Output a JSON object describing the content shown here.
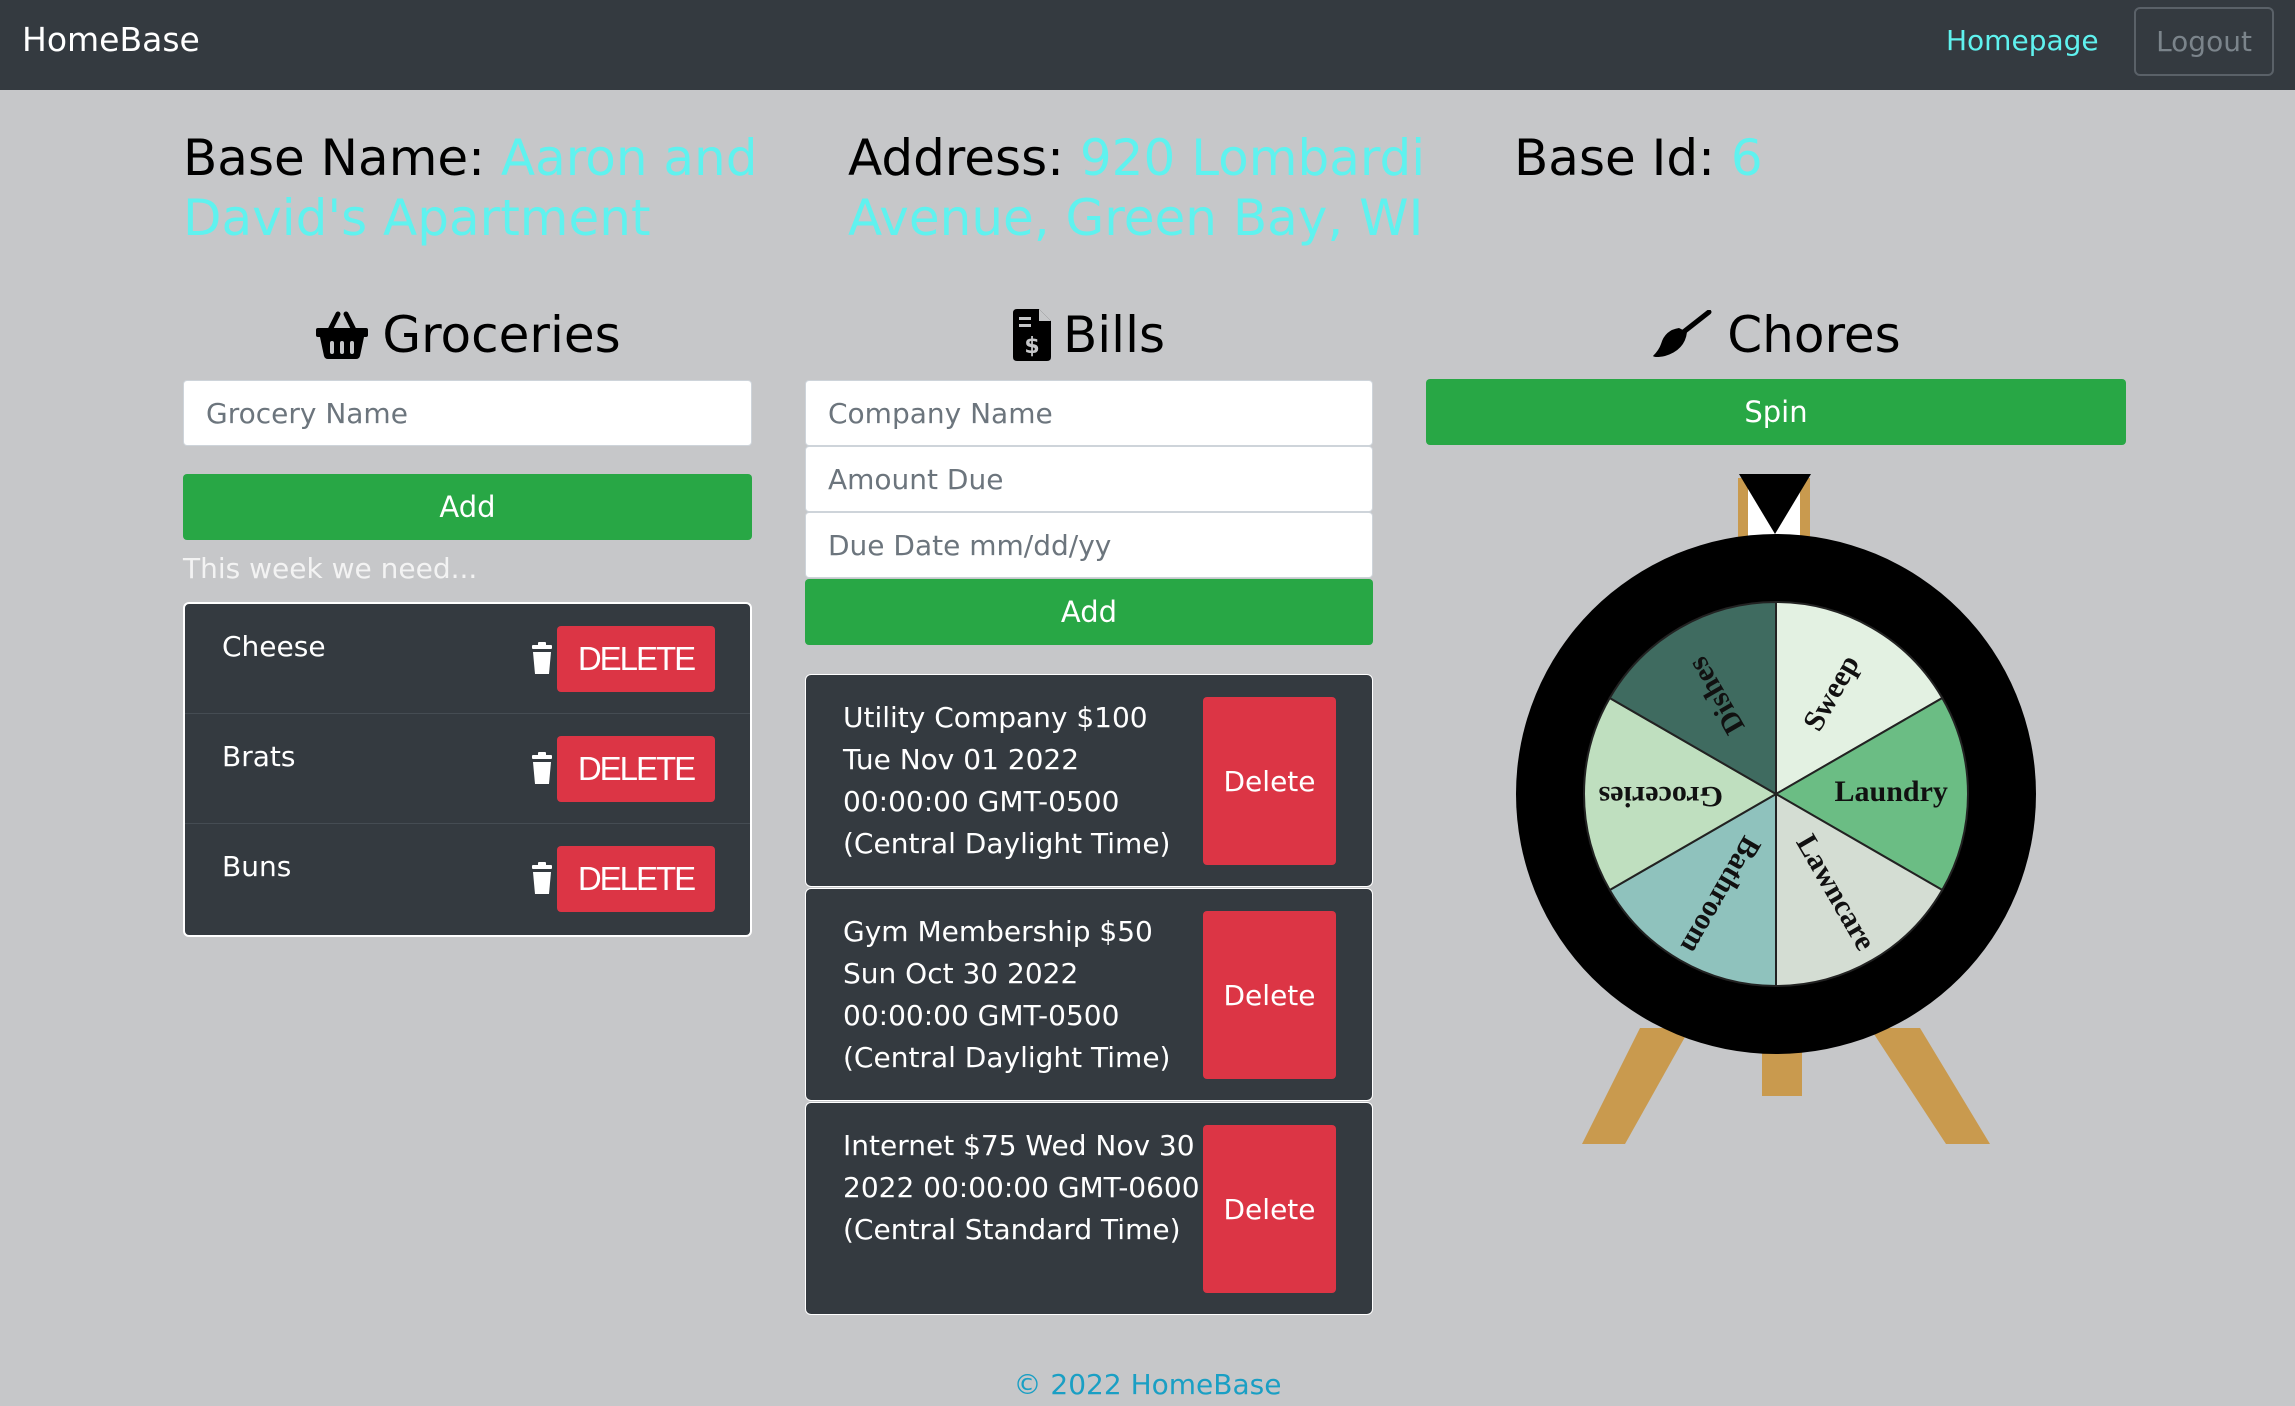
{
  "navbar": {
    "brand": "HomeBase",
    "homepage_link": "Homepage",
    "logout_button": "Logout"
  },
  "base_info": {
    "name_label": "Base Name:",
    "name_value": "Aaron and David's Apartment",
    "address_label": "Address:",
    "address_value": "920 Lombardi Avenue, Green Bay, WI",
    "id_label": "Base Id:",
    "id_value": "6"
  },
  "groceries": {
    "heading": "Groceries",
    "icon": "basket-icon",
    "input_placeholder": "Grocery Name",
    "add_button": "Add",
    "hint": "This week we need...",
    "items": [
      {
        "name": "Cheese",
        "delete_label": "DELETE"
      },
      {
        "name": "Brats",
        "delete_label": "DELETE"
      },
      {
        "name": "Buns",
        "delete_label": "DELETE"
      }
    ]
  },
  "bills": {
    "heading": "Bills",
    "icon": "invoice-dollar-icon",
    "company_placeholder": "Company Name",
    "amount_placeholder": "Amount Due",
    "date_placeholder": "Due Date mm/dd/yy",
    "add_button": "Add",
    "items": [
      {
        "text": "Utility Company $100 Tue Nov 01 2022 00:00:00 GMT-0500 (Central Daylight Time)",
        "delete_label": "Delete"
      },
      {
        "text": "Gym Membership $50 Sun Oct 30 2022 00:00:00 GMT-0500 (Central Daylight Time)",
        "delete_label": "Delete"
      },
      {
        "text": "Internet $75 Wed Nov 30 2022 00:00:00 GMT-0600 (Central Standard Time)",
        "delete_label": "Delete"
      }
    ]
  },
  "chores": {
    "heading": "Chores",
    "icon": "broom-icon",
    "spin_button": "Spin",
    "wheel": {
      "segments": [
        {
          "label": "Sweep",
          "color": "#e3f1e2"
        },
        {
          "label": "Laundry",
          "color": "#6bbd84"
        },
        {
          "label": "Lawncare",
          "color": "#d4ddd3"
        },
        {
          "label": "Bathroom",
          "color": "#8fc2bd"
        },
        {
          "label": "Groceries",
          "color": "#bfdfbf"
        },
        {
          "label": "Dishes",
          "color": "#3f6b60"
        }
      ],
      "rim_color": "#000000",
      "stand_color": "#c99a4e"
    }
  },
  "footer": {
    "text": "© 2022 HomeBase"
  },
  "colors": {
    "accent": "#5ff2ef",
    "success": "#28a745",
    "danger": "#dc3545",
    "dark": "#343a40",
    "footer_link": "#1a9fc4"
  }
}
